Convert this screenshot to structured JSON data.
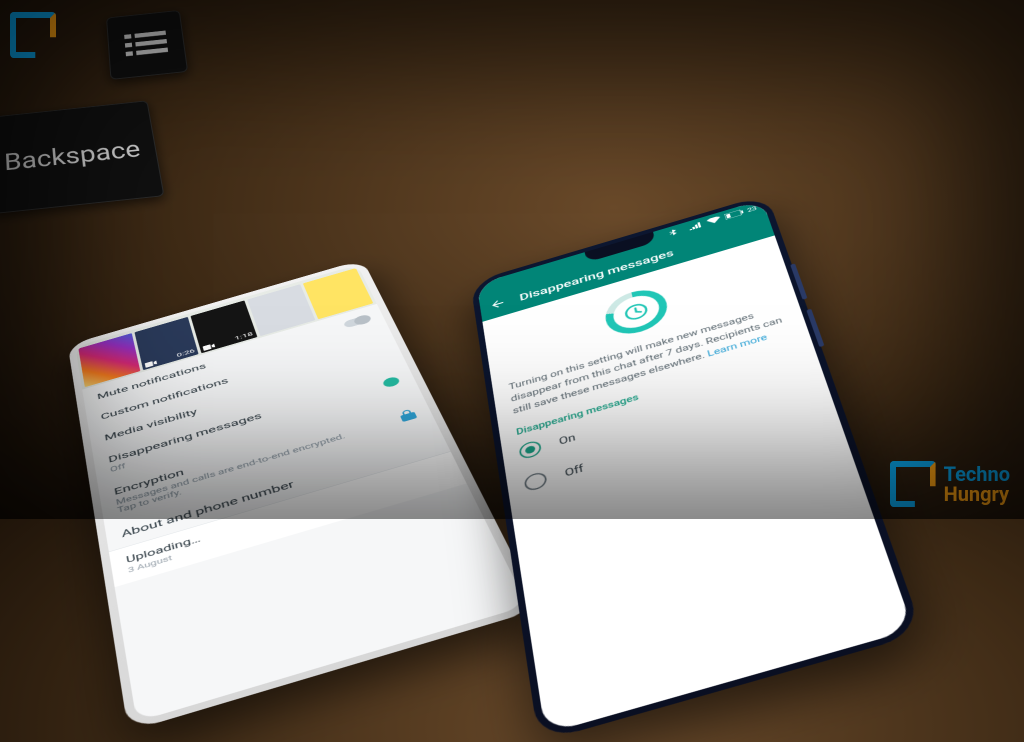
{
  "brand": {
    "line1": "Techno",
    "line2": "Hungry"
  },
  "keyboard": {
    "backspace": "Backspace"
  },
  "left_phone": {
    "thumbs": [
      {
        "duration": ""
      },
      {
        "duration": "0:26"
      },
      {
        "duration": "1:18"
      },
      {
        "duration": ""
      },
      {
        "duration": ""
      }
    ],
    "items": {
      "mute": {
        "title": "Mute notifications"
      },
      "custom": {
        "title": "Custom notifications"
      },
      "media": {
        "title": "Media visibility"
      },
      "disappear": {
        "title": "Disappearing messages",
        "sub": "Off"
      },
      "encryption": {
        "title": "Encryption",
        "sub": "Messages and calls are end-to-end encrypted. Tap to verify."
      },
      "about": {
        "title": "About and phone number"
      }
    },
    "upload": {
      "title": "Uploading…",
      "sub": "3 August"
    }
  },
  "right_phone": {
    "status": {
      "time": "",
      "battery": "23"
    },
    "appbar": {
      "title": "Disappearing messages"
    },
    "description": "Turning on this setting will make new messages disappear from this chat after 7 days. Recipients can still save these messages elsewhere.",
    "learn_more": "Learn more",
    "section": "Disappearing messages",
    "options": {
      "on": "On",
      "off": "Off"
    },
    "selected": "on"
  }
}
